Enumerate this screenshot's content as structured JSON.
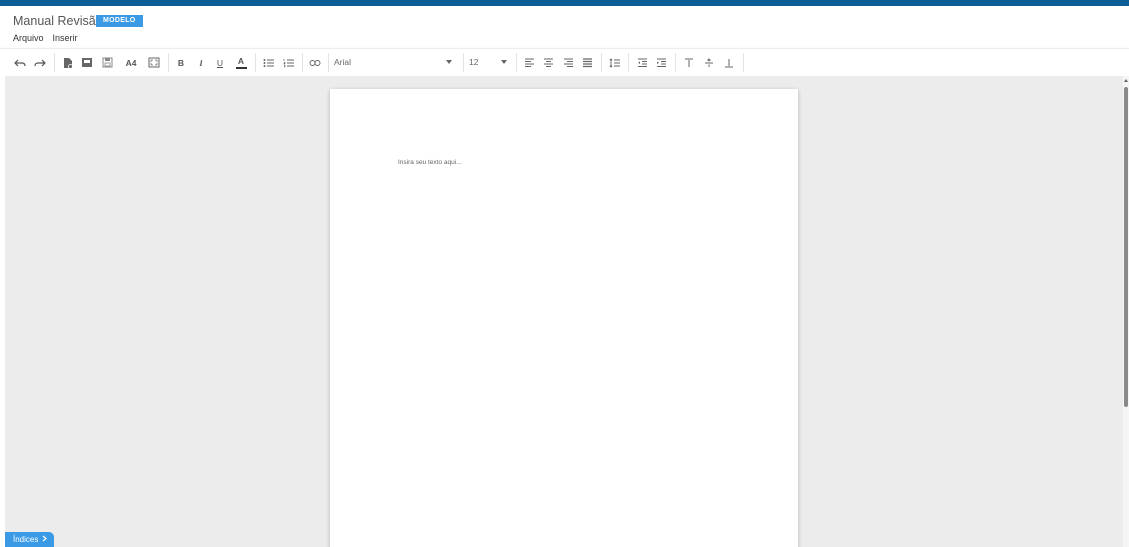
{
  "header": {
    "title": "Manual Revisão",
    "badge": "MODELO"
  },
  "menu": {
    "items": [
      "Arquivo",
      "Inserir"
    ]
  },
  "toolbar": {
    "page_size_label": "A4",
    "bold_label": "B",
    "italic_label": "I",
    "underline_label": "U",
    "text_color_label": "A",
    "font_family": "Arial",
    "font_size": "12",
    "icons": [
      "undo-icon",
      "redo-icon",
      "new-document-icon",
      "template-icon",
      "save-icon",
      "page-size-a4",
      "fullscreen-icon",
      "bold",
      "italic",
      "underline",
      "text-color",
      "bullet-list-icon",
      "numbered-list-icon",
      "link-icon",
      "align-left-icon",
      "align-center-icon",
      "align-right-icon",
      "align-justify-icon",
      "line-height-icon",
      "indent-decrease-icon",
      "indent-increase-icon",
      "valign-top-icon",
      "valign-middle-icon",
      "valign-bottom-icon"
    ]
  },
  "editor": {
    "placeholder": "Insira seu texto aqui..."
  },
  "sidebar_toggle": {
    "label": "Índices"
  },
  "colors": {
    "top_strip": "#0c5e97",
    "accent": "#3a9ae6",
    "workspace": "#ececec"
  }
}
